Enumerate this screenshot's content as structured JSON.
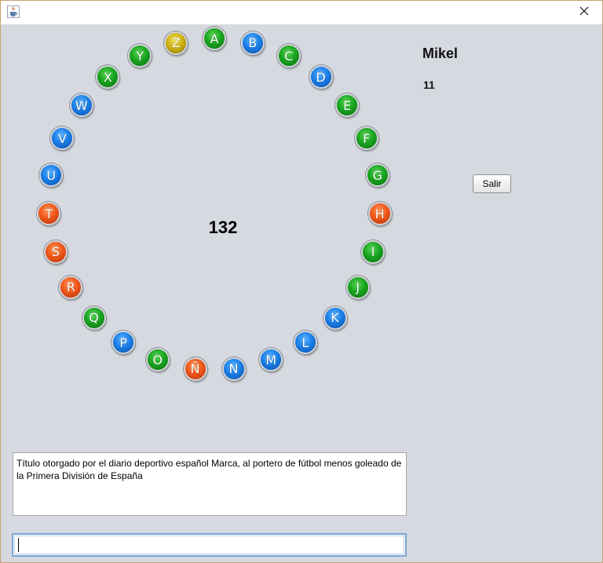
{
  "window": {
    "icon": "java-cup-icon",
    "close_glyph": "✕"
  },
  "rosco": {
    "score": "132",
    "letters": [
      {
        "letter": "A",
        "color": "green"
      },
      {
        "letter": "B",
        "color": "blue"
      },
      {
        "letter": "C",
        "color": "green"
      },
      {
        "letter": "D",
        "color": "blue"
      },
      {
        "letter": "E",
        "color": "green"
      },
      {
        "letter": "F",
        "color": "green"
      },
      {
        "letter": "G",
        "color": "green"
      },
      {
        "letter": "H",
        "color": "orange"
      },
      {
        "letter": "I",
        "color": "green"
      },
      {
        "letter": "J",
        "color": "green"
      },
      {
        "letter": "K",
        "color": "blue"
      },
      {
        "letter": "L",
        "color": "blue"
      },
      {
        "letter": "M",
        "color": "blue"
      },
      {
        "letter": "N",
        "color": "blue"
      },
      {
        "letter": "Ñ",
        "color": "orange"
      },
      {
        "letter": "O",
        "color": "green"
      },
      {
        "letter": "P",
        "color": "blue"
      },
      {
        "letter": "Q",
        "color": "green"
      },
      {
        "letter": "R",
        "color": "orange"
      },
      {
        "letter": "S",
        "color": "orange"
      },
      {
        "letter": "T",
        "color": "orange"
      },
      {
        "letter": "U",
        "color": "blue"
      },
      {
        "letter": "V",
        "color": "blue"
      },
      {
        "letter": "W",
        "color": "blue"
      },
      {
        "letter": "X",
        "color": "green"
      },
      {
        "letter": "Y",
        "color": "green"
      },
      {
        "letter": "Z",
        "color": "yellow"
      }
    ]
  },
  "player": {
    "name": "Mikel",
    "hits": "11"
  },
  "buttons": {
    "exit_label": "Salir"
  },
  "clue": {
    "text": "Título otorgado por el diario deportivo español Marca, al portero de fútbol menos goleado de la Primera División de España"
  },
  "answer": {
    "value": ""
  }
}
